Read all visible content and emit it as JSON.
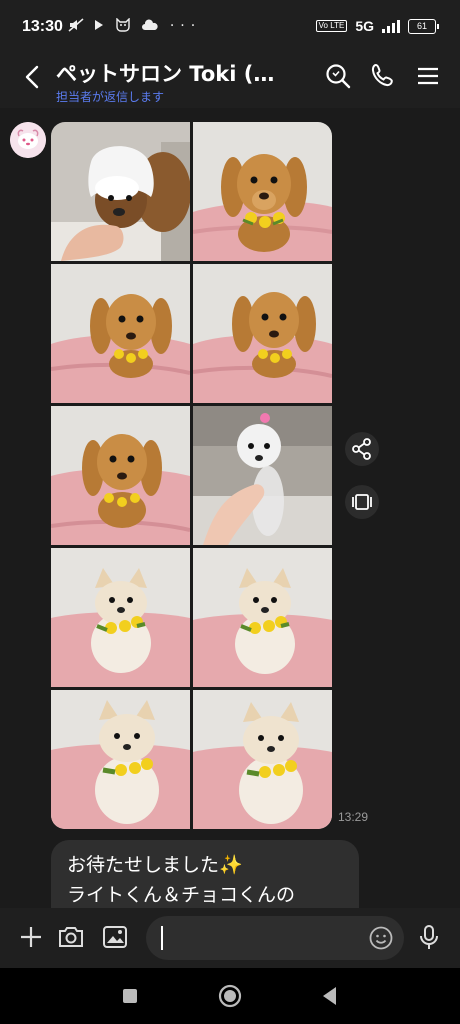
{
  "status_bar": {
    "time": "13:30",
    "network": "5G",
    "volte": "Vo LTE",
    "battery": "61"
  },
  "header": {
    "title": "ペットサロン Toki (…",
    "subtitle": "担当者が返信します",
    "icons": [
      "back-icon",
      "search-icon",
      "phone-icon",
      "menu-icon"
    ]
  },
  "chat": {
    "photo_count": 10,
    "timestamp": "13:29",
    "message_lines": [
      "お待たせしました✨",
      "ライトくん＆チョコくんの"
    ]
  },
  "input_bar": {
    "value": "",
    "placeholder": ""
  },
  "colors": {
    "background": "#1b1b1b",
    "bubble": "#2f2f2f",
    "subtitle": "#5b7cf0",
    "photo_blanket": "#e6a9ad"
  }
}
